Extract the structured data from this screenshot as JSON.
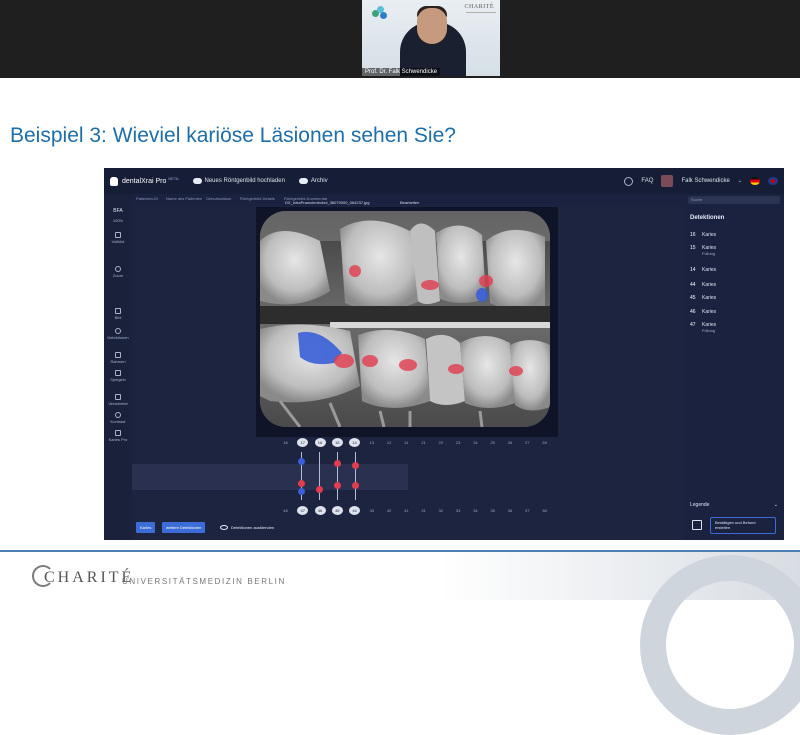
{
  "video": {
    "speaker_name": "Prof. Dr. Falk Schwendicke",
    "speaker_logo_text": "CHARITÉ"
  },
  "slide": {
    "title": "Beispiel 3: Wieviel kariöse Läsionen sehen Sie?"
  },
  "app": {
    "brand": "dentalXrai Pro",
    "beta": "BETA",
    "upload_btn": "Neues Röntgenbild hochladen",
    "archive_btn": "Archiv",
    "faq": "FAQ",
    "user_name": "Falk Schwendicke",
    "tabs": [
      "Patienten-ID",
      "Name des Patienten",
      "Geburtsdatum",
      "Röntgenbild Details",
      "Röntgenbild-Kommentar"
    ],
    "file_name": "DX_intraPramolenbvkrd_36070000_064237.jpg",
    "edit_label": "Bearbeiten",
    "sidebar": [
      {
        "label": "BFA"
      },
      {
        "label": "100%"
      },
      {
        "label": "Vollbild"
      },
      {
        "label": "Zoom"
      },
      {
        "label": "Bild"
      },
      {
        "label": "Detektionen"
      },
      {
        "label": "Rahmen"
      },
      {
        "label": "Spiegeln"
      },
      {
        "label": "Verarbeitet"
      },
      {
        "label": "Kontrast"
      },
      {
        "label": "Karies Pro"
      }
    ],
    "upper_numbers": [
      "18",
      "17",
      "16",
      "15",
      "14",
      "13",
      "12",
      "11",
      "21",
      "22",
      "23",
      "24",
      "25",
      "26",
      "27",
      "28"
    ],
    "upper_active": [
      "17",
      "16",
      "15",
      "14"
    ],
    "lower_numbers": [
      "48",
      "47",
      "46",
      "45",
      "44",
      "43",
      "42",
      "41",
      "31",
      "32",
      "33",
      "34",
      "35",
      "36",
      "37",
      "38"
    ],
    "lower_active": [
      "47",
      "46",
      "45",
      "44"
    ],
    "buttons": {
      "karies": "Karies",
      "weitere": "weitere Detektionen",
      "toggle": "Detektionen ausblenden"
    },
    "right_panel": {
      "search_placeholder": "Suche",
      "heading": "Detektionen",
      "detections": [
        {
          "tooth": "16",
          "label": "Karies",
          "sub": ""
        },
        {
          "tooth": "15",
          "label": "Karies",
          "sub": "Füllung"
        },
        {
          "tooth": "14",
          "label": "Karies",
          "sub": ""
        },
        {
          "tooth": "44",
          "label": "Karies",
          "sub": ""
        },
        {
          "tooth": "45",
          "label": "Karies",
          "sub": ""
        },
        {
          "tooth": "46",
          "label": "Karies",
          "sub": ""
        },
        {
          "tooth": "47",
          "label": "Karies",
          "sub": "Füllung"
        }
      ],
      "legend": "Legende",
      "confirm": "Bestätigen und Befund erstellen"
    }
  },
  "footer": {
    "charite": "CHARITÉ",
    "subtitle": "UNIVERSITÄTSMEDIZIN BERLIN"
  },
  "colors": {
    "caries": "#e23c4e",
    "filling": "#3a5fd8",
    "accent": "#3c6cd8",
    "title": "#1e6ea8"
  }
}
